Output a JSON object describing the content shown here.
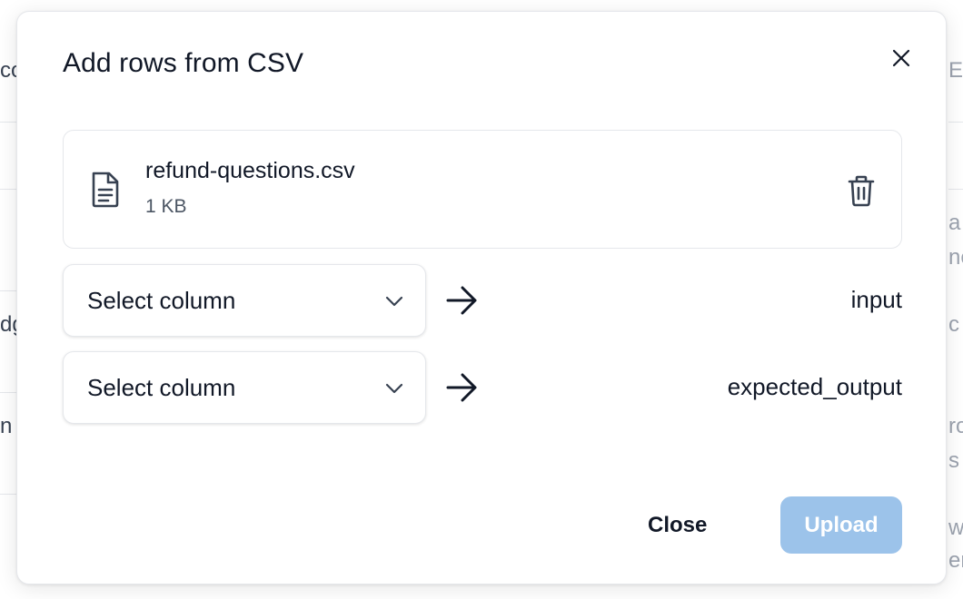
{
  "background": {
    "left_fragments": [
      "co",
      "dg",
      "n"
    ],
    "right_fragments": [
      "ES",
      "a",
      "ne",
      "c",
      "ro",
      "s",
      "w",
      "ers"
    ]
  },
  "dialog": {
    "title": "Add rows from CSV",
    "close_icon": "close-icon",
    "file": {
      "name": "refund-questions.csv",
      "size": "1 KB",
      "icon": "file-text-icon",
      "remove_icon": "trash-icon"
    },
    "mappings": [
      {
        "select_label": "Select column",
        "target": "input"
      },
      {
        "select_label": "Select column",
        "target": "expected_output"
      }
    ],
    "buttons": {
      "close_label": "Close",
      "upload_label": "Upload"
    },
    "colors": {
      "upload_disabled_bg": "#9cc3ea",
      "text": "#111827"
    }
  }
}
